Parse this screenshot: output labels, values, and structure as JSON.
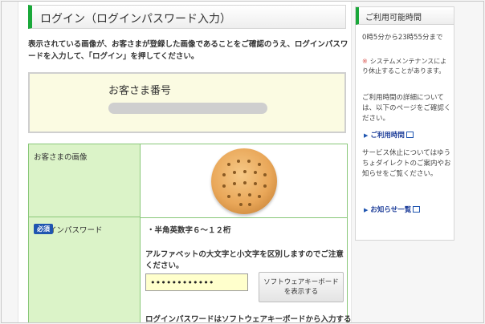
{
  "page": {
    "title": "ログイン（ログインパスワード入力）",
    "intro": "表示されている画像が、お客さまが登録した画像であることをご確認のうえ、ログインパスワードを入力して、「ログイン」を押してください。"
  },
  "customer": {
    "label": "お客さま番号"
  },
  "table": {
    "image_label": "お客さまの画像",
    "password_label": "ログインパスワード",
    "required_badge": "必須",
    "rule": "・半角英数字６〜１２桁",
    "case_note": "アルファベットの大文字と小文字を区別しますのでご注意ください。",
    "password_value": "••••••••••••",
    "keyboard_button_line1": "ソフトウェアキーボード",
    "keyboard_button_line2": "を表示する",
    "bottom_note": "ログインパスワードはソフトウェアキーボードから入力する"
  },
  "sidebar": {
    "heading": "ご利用可能時間",
    "hours": "0時5分から23時55分まで",
    "maintenance_mark": "※",
    "maintenance": "システムメンテナンスにより休止することがあります。",
    "details": "ご利用時間の詳細については、以下のページをご確認ください。",
    "link_hours": "ご利用時間",
    "suspension": "サービス休止についてはゆうちょダイレクトのご案内やお知らせをご覧ください。",
    "link_news": "お知らせ一覧"
  },
  "colors": {
    "accent_green": "#1aa83a",
    "table_header_bg": "#dbf3c8",
    "password_bg": "#ffffcc",
    "link_blue": "#1f3f9a",
    "badge_blue": "#1f55b0"
  },
  "icons": [
    "external-link-icon",
    "arrow-right-icon",
    "cookie-image"
  ]
}
